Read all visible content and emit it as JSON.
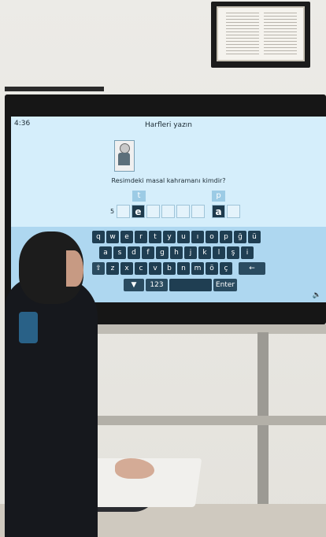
{
  "screen": {
    "time": "4:36",
    "title": "Harfleri yazın",
    "question": "Resimdeki masal kahramanı kimdir?",
    "letter_count": "5",
    "hint_letters": [
      "t",
      "p"
    ],
    "slots": [
      "",
      "e",
      "",
      "",
      "",
      "",
      "a",
      ""
    ],
    "speaker_icon": "speaker-icon"
  },
  "keyboard": {
    "row1": [
      "q",
      "w",
      "e",
      "r",
      "t",
      "y",
      "u",
      "ı",
      "o",
      "p",
      "ğ",
      "ü"
    ],
    "row2": [
      "a",
      "s",
      "d",
      "f",
      "g",
      "h",
      "j",
      "k",
      "l",
      "ş",
      "i"
    ],
    "row3": [
      "⇧",
      "z",
      "x",
      "c",
      "v",
      "b",
      "n",
      "m",
      "ö",
      "ç",
      "←"
    ],
    "row4": [
      "▼",
      "123",
      "",
      "Enter"
    ]
  }
}
